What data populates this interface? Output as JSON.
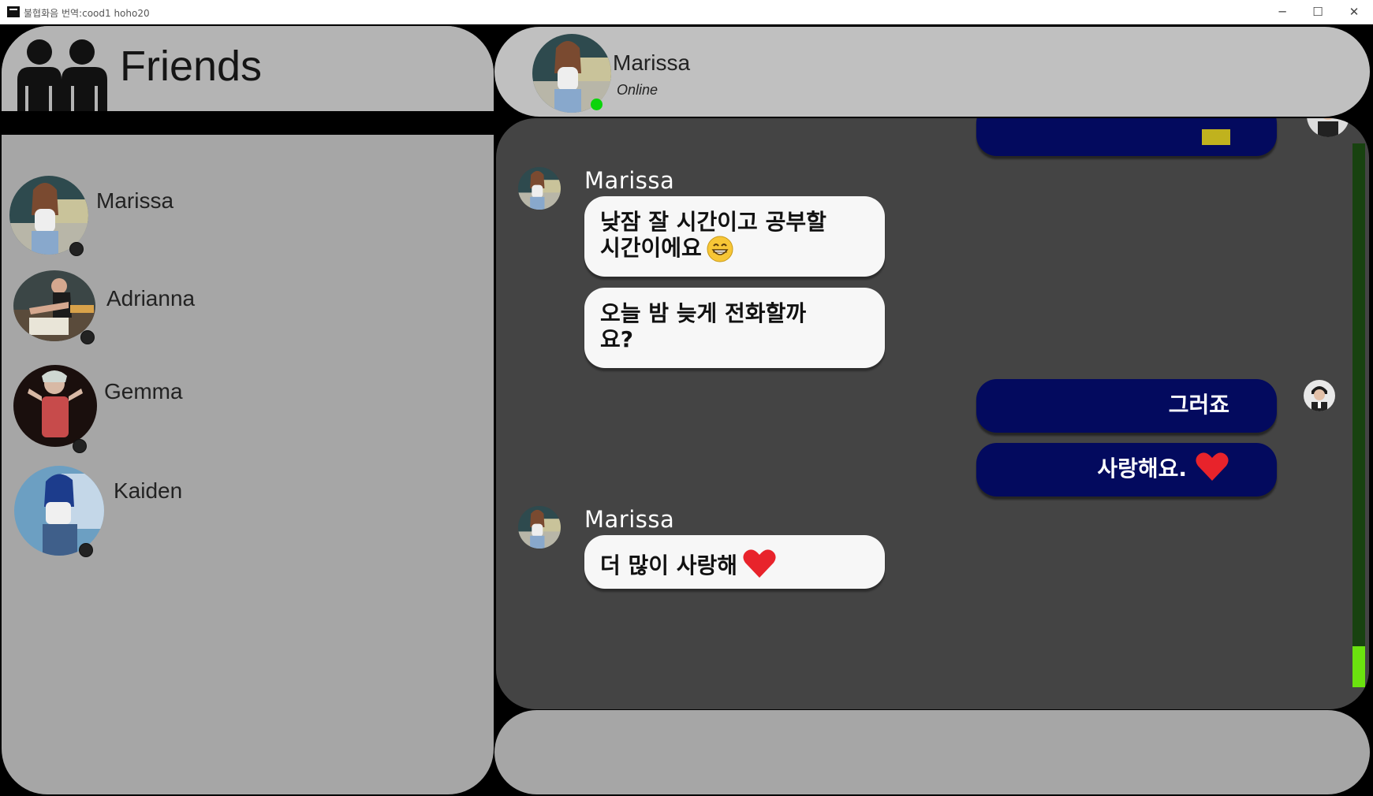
{
  "window": {
    "title": "불협화음  번역:cood1 hoho20",
    "controls": [
      "─",
      "☐",
      "✕"
    ]
  },
  "sidebar": {
    "title": "Friends",
    "friends": [
      {
        "name": "Marissa",
        "status": "offline"
      },
      {
        "name": "Adrianna",
        "status": "offline"
      },
      {
        "name": "Gemma",
        "status": "offline"
      },
      {
        "name": "Kaiden",
        "status": "offline"
      }
    ]
  },
  "chat_header": {
    "name": "Marissa",
    "status": "Online"
  },
  "messages": [
    {
      "from": "me",
      "text": "",
      "partial": true
    },
    {
      "from": "Marissa",
      "sender_label": "Marissa",
      "text_line1": "낮잠 잘 시간이고 공부할",
      "text_line2": "시간이에요",
      "emoji": "grin-icon"
    },
    {
      "from": "Marissa",
      "text_line1": "오늘 밤 늦게 전화할까",
      "text_line2": "요?"
    },
    {
      "from": "me",
      "text": "그러죠"
    },
    {
      "from": "me",
      "text": "사랑해요.",
      "emoji": "heart-icon"
    },
    {
      "from": "Marissa",
      "sender_label": "Marissa",
      "text": "더 많이 사랑해",
      "emoji": "heart-icon"
    }
  ],
  "colors": {
    "incoming_bubble": "#f7f7f7",
    "outgoing_bubble": "#030a5e",
    "online": "#0bd40b",
    "scroll_thumb": "#6be20f",
    "heart": "#e8232b"
  }
}
